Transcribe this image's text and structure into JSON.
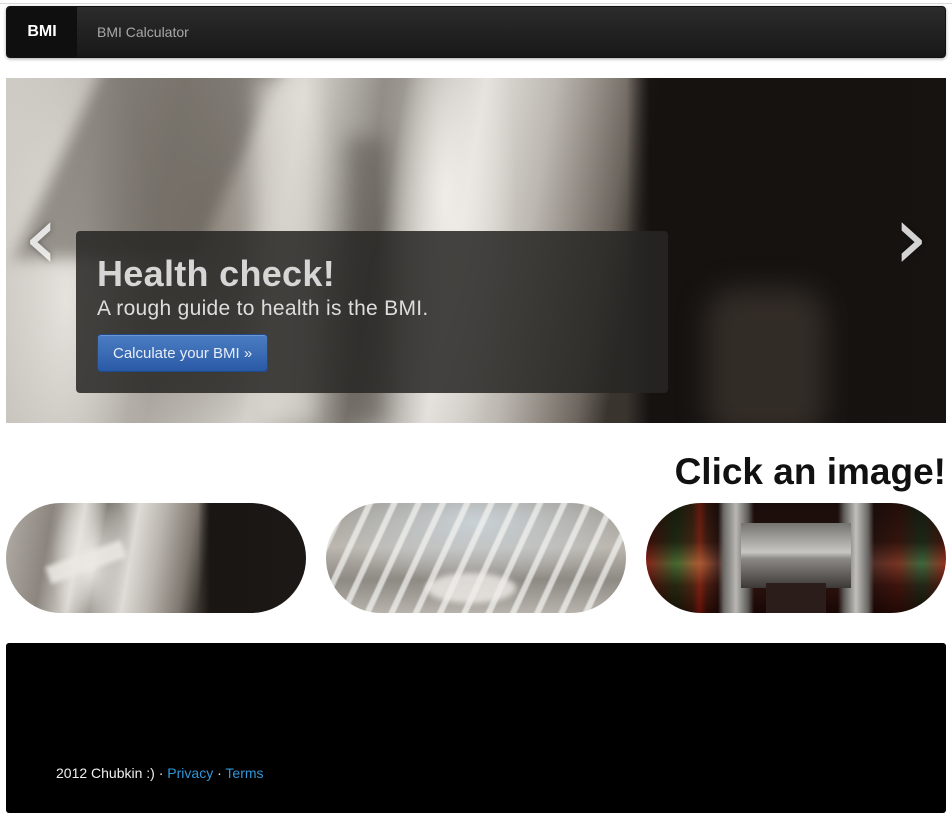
{
  "navbar": {
    "brand": "BMI",
    "links": [
      "BMI Calculator"
    ]
  },
  "carousel": {
    "prev_icon": "chevron-left-icon",
    "next_icon": "chevron-right-icon",
    "prev_glyph": "‹",
    "next_glyph": "›",
    "caption": {
      "heading": "Health check!",
      "text": "A rough guide to health is the BMI.",
      "button_label": "Calculate your BMI »"
    }
  },
  "gallery": {
    "heading": "Click an image!"
  },
  "footer": {
    "copyright": "2012 Chubkin :)",
    "separator": "·",
    "privacy": "Privacy",
    "terms": "Terms"
  },
  "colors": {
    "navbar": "#1f1f1f",
    "button": "#3a6ab5",
    "link": "#2f96d9",
    "footer": "#000000"
  }
}
